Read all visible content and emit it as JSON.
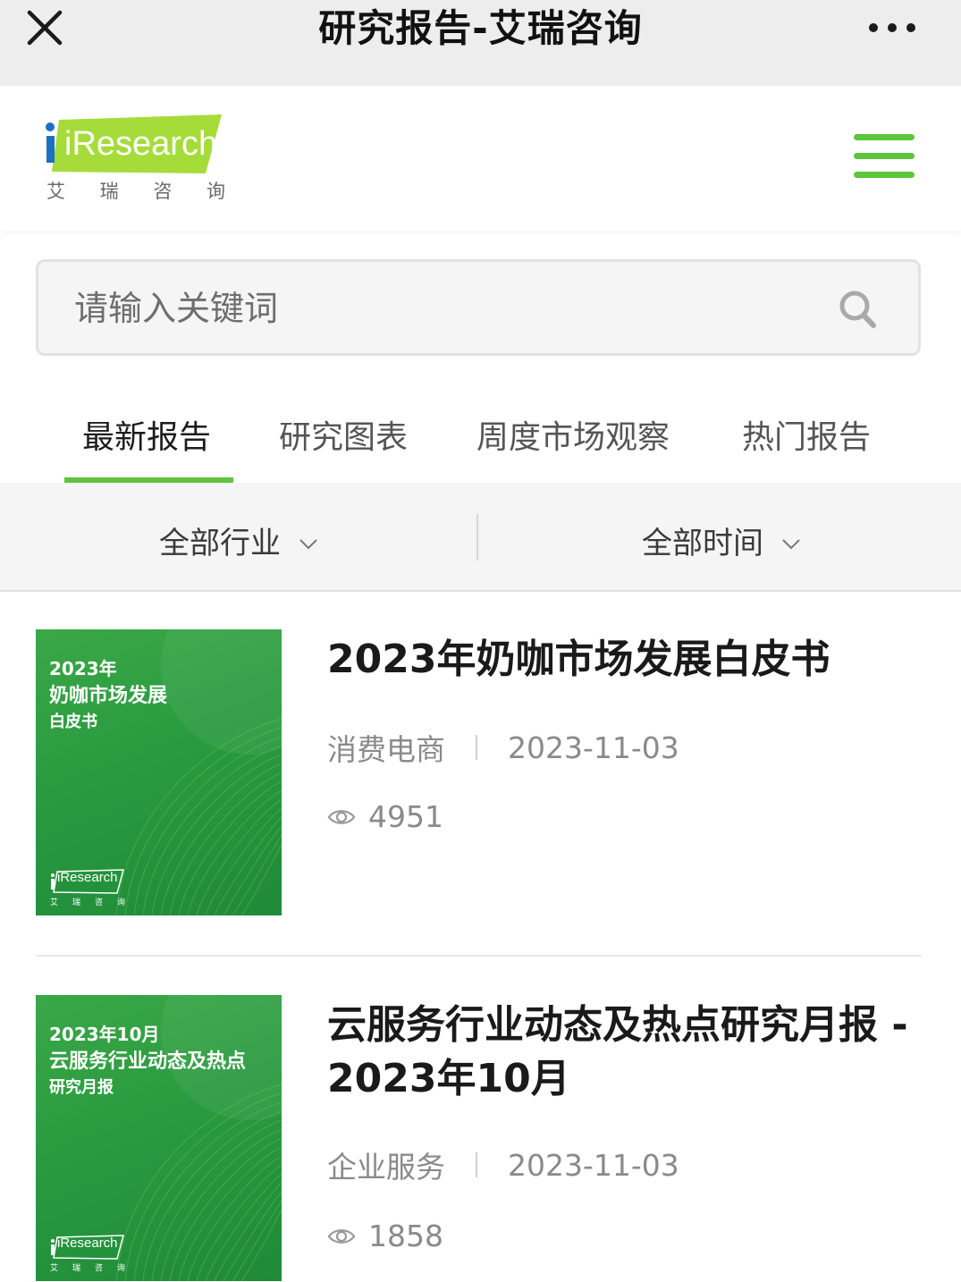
{
  "window": {
    "title": "研究报告-艾瑞咨询",
    "close_icon": "close-icon",
    "more_icon": "more-dots-icon"
  },
  "header": {
    "logo_text": "iResearch",
    "logo_sub": [
      "艾",
      "瑞",
      "咨",
      "询"
    ],
    "menu_icon": "hamburger-menu-icon",
    "accent_color": "#5cc53c"
  },
  "search": {
    "placeholder": "请输入关键词",
    "value": "",
    "icon": "search-icon"
  },
  "tabs": [
    {
      "label": "最新报告",
      "active": true
    },
    {
      "label": "研究图表",
      "active": false
    },
    {
      "label": "周度市场观察",
      "active": false
    },
    {
      "label": "热门报告",
      "active": false
    }
  ],
  "filters": {
    "industry": "全部行业",
    "time": "全部时间"
  },
  "reports": [
    {
      "title": "2023年奶咖市场发展白皮书",
      "category": "消费电商",
      "date": "2023-11-03",
      "views": "4951",
      "cover_lines": [
        "2023年",
        "奶咖市场发展",
        "白皮书"
      ],
      "cover_logo": "iResearch",
      "cover_logo_sub": [
        "艾",
        "瑞",
        "咨",
        "询"
      ]
    },
    {
      "title": "云服务行业动态及热点研究月报 - 2023年10月",
      "category": "企业服务",
      "date": "2023-11-03",
      "views": "1858",
      "cover_lines": [
        "2023年10月",
        "云服务行业动态及热点",
        "研究月报"
      ],
      "cover_logo": "iResearch",
      "cover_logo_sub": [
        "艾",
        "瑞",
        "咨",
        "询"
      ]
    }
  ]
}
